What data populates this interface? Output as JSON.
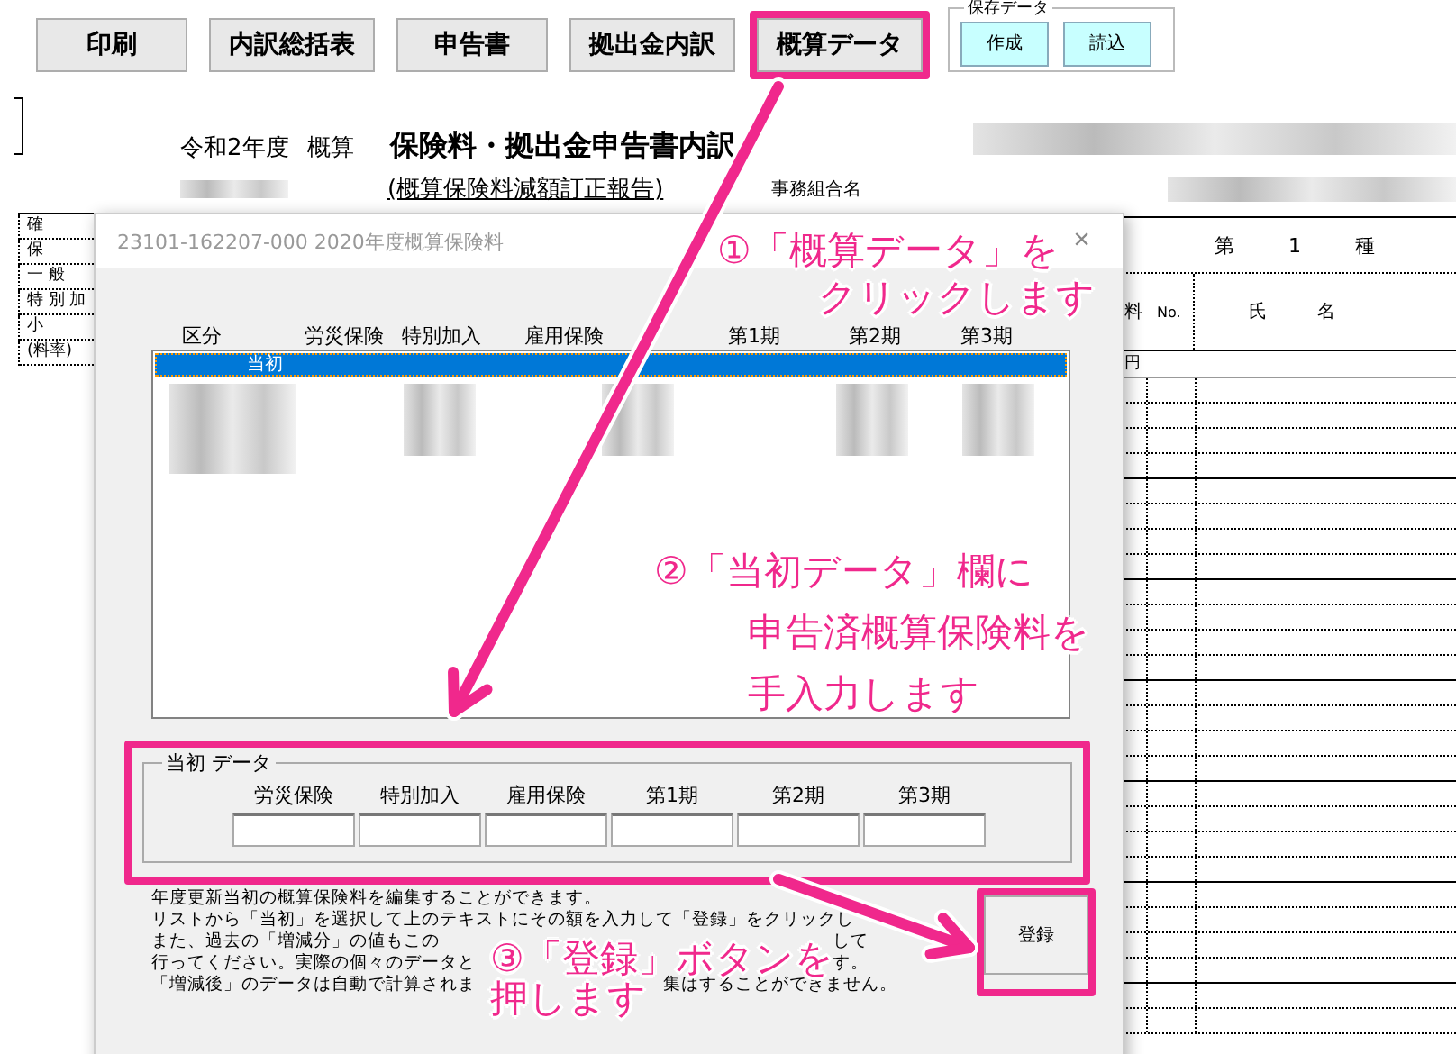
{
  "toolbar": {
    "buttons": [
      {
        "label": "印刷",
        "highlighted": false
      },
      {
        "label": "内訳総括表",
        "highlighted": false
      },
      {
        "label": "申告書",
        "highlighted": false
      },
      {
        "label": "拠出金内訳",
        "highlighted": false
      },
      {
        "label": "概算データ",
        "highlighted": true
      }
    ]
  },
  "save_data": {
    "title": "保存データ",
    "buttons": [
      "作成",
      "読込"
    ]
  },
  "sheet": {
    "year": "令和2年度",
    "kind": "概算",
    "title": "保険料・拠出金申告書内訳",
    "subtitle": "(概算保険料減額訂正報告)",
    "association_label": "事務組合名",
    "left_labels": [
      "確",
      "保",
      "一 般",
      "特 別 加",
      "小",
      "(料率)"
    ],
    "right_header": [
      "第",
      "1",
      "種"
    ],
    "right_subheader": [
      "料",
      "No.",
      "氏",
      "名"
    ],
    "unit": "円"
  },
  "dialog": {
    "title": "23101-162207-000 2020年度概算保険料",
    "close": "×",
    "columns": [
      "区分",
      "労災保険",
      "特別加入",
      "雇用保険",
      "第1期",
      "第2期",
      "第3期"
    ],
    "rows": [
      {
        "label": "当初",
        "selected": true
      }
    ],
    "group": {
      "title": "当初 データ",
      "highlighted": true,
      "fields": [
        "労災保険",
        "特別加入",
        "雇用保険",
        "第1期",
        "第2期",
        "第3期"
      ]
    },
    "help_lines": [
      [
        "年度更新当初の概算保険料を編集することができます。"
      ],
      [
        "リストから「当初」を選択して上のテキストにその額を入力して「登録」をクリックし"
      ],
      [
        "また、過去の「増減分」の値もこの",
        "して"
      ],
      [
        "行ってください。実際の個々のデータと",
        "す。"
      ],
      [
        "「増減後」のデータは自動で計算されま",
        "集はすることができません。"
      ]
    ],
    "register": {
      "label": "登録",
      "highlighted": true
    }
  },
  "annotations": [
    {
      "lines": [
        "①「概算データ」を",
        "クリックします"
      ]
    },
    {
      "lines": [
        "②「当初データ」欄に",
        "申告済概算保険料を",
        "手入力します"
      ]
    },
    {
      "lines": [
        "③「登録」ボタンを",
        "押します"
      ]
    }
  ]
}
